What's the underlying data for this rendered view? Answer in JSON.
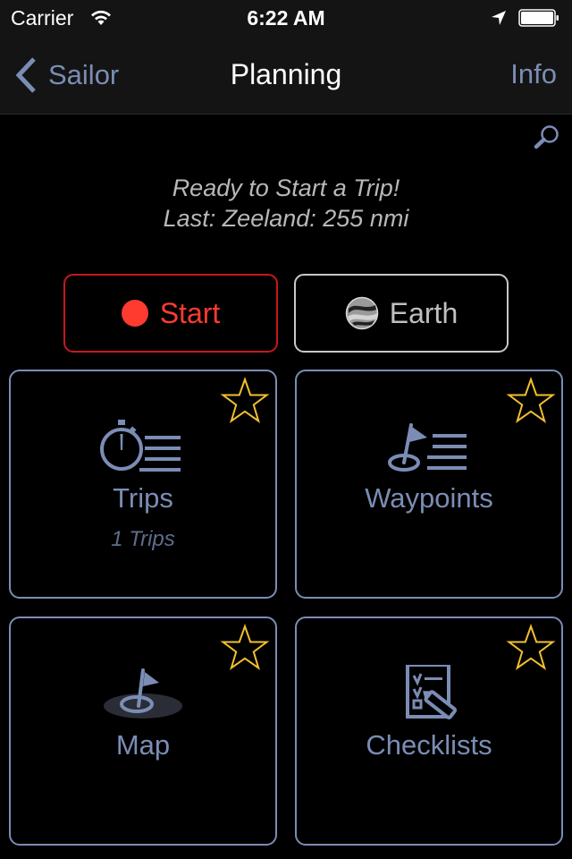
{
  "status_bar": {
    "carrier": "Carrier",
    "time": "6:22 AM",
    "icons": [
      "wifi-icon",
      "location-arrow-icon",
      "battery-icon"
    ]
  },
  "nav_bar": {
    "back_label": "Sailor",
    "title": "Planning",
    "right_label": "Info"
  },
  "search": {
    "icon": "search-icon"
  },
  "status_message": {
    "line1": "Ready to Start a Trip!",
    "line2": "Last: Zeeland: 255 nmi"
  },
  "actions": {
    "start": {
      "label": "Start",
      "icon": "record-dot-icon",
      "color": "#ff3b30"
    },
    "earth": {
      "label": "Earth",
      "icon": "google-earth-icon"
    }
  },
  "tiles": [
    {
      "label": "Trips",
      "subtitle": "1 Trips",
      "icon": "stopwatch-list-icon",
      "favorite_icon": "star-outline-icon"
    },
    {
      "label": "Waypoints",
      "subtitle": "",
      "icon": "flag-list-icon",
      "favorite_icon": "star-outline-icon"
    },
    {
      "label": "Map",
      "subtitle": "",
      "icon": "map-flag-icon",
      "favorite_icon": "star-outline-icon"
    },
    {
      "label": "Checklists",
      "subtitle": "",
      "icon": "checklist-icon",
      "favorite_icon": "star-outline-icon"
    }
  ],
  "colors": {
    "accent": "#7b8db5",
    "star": "#f2c02e",
    "start_red": "#ff3b30",
    "start_border": "#c4191b"
  }
}
